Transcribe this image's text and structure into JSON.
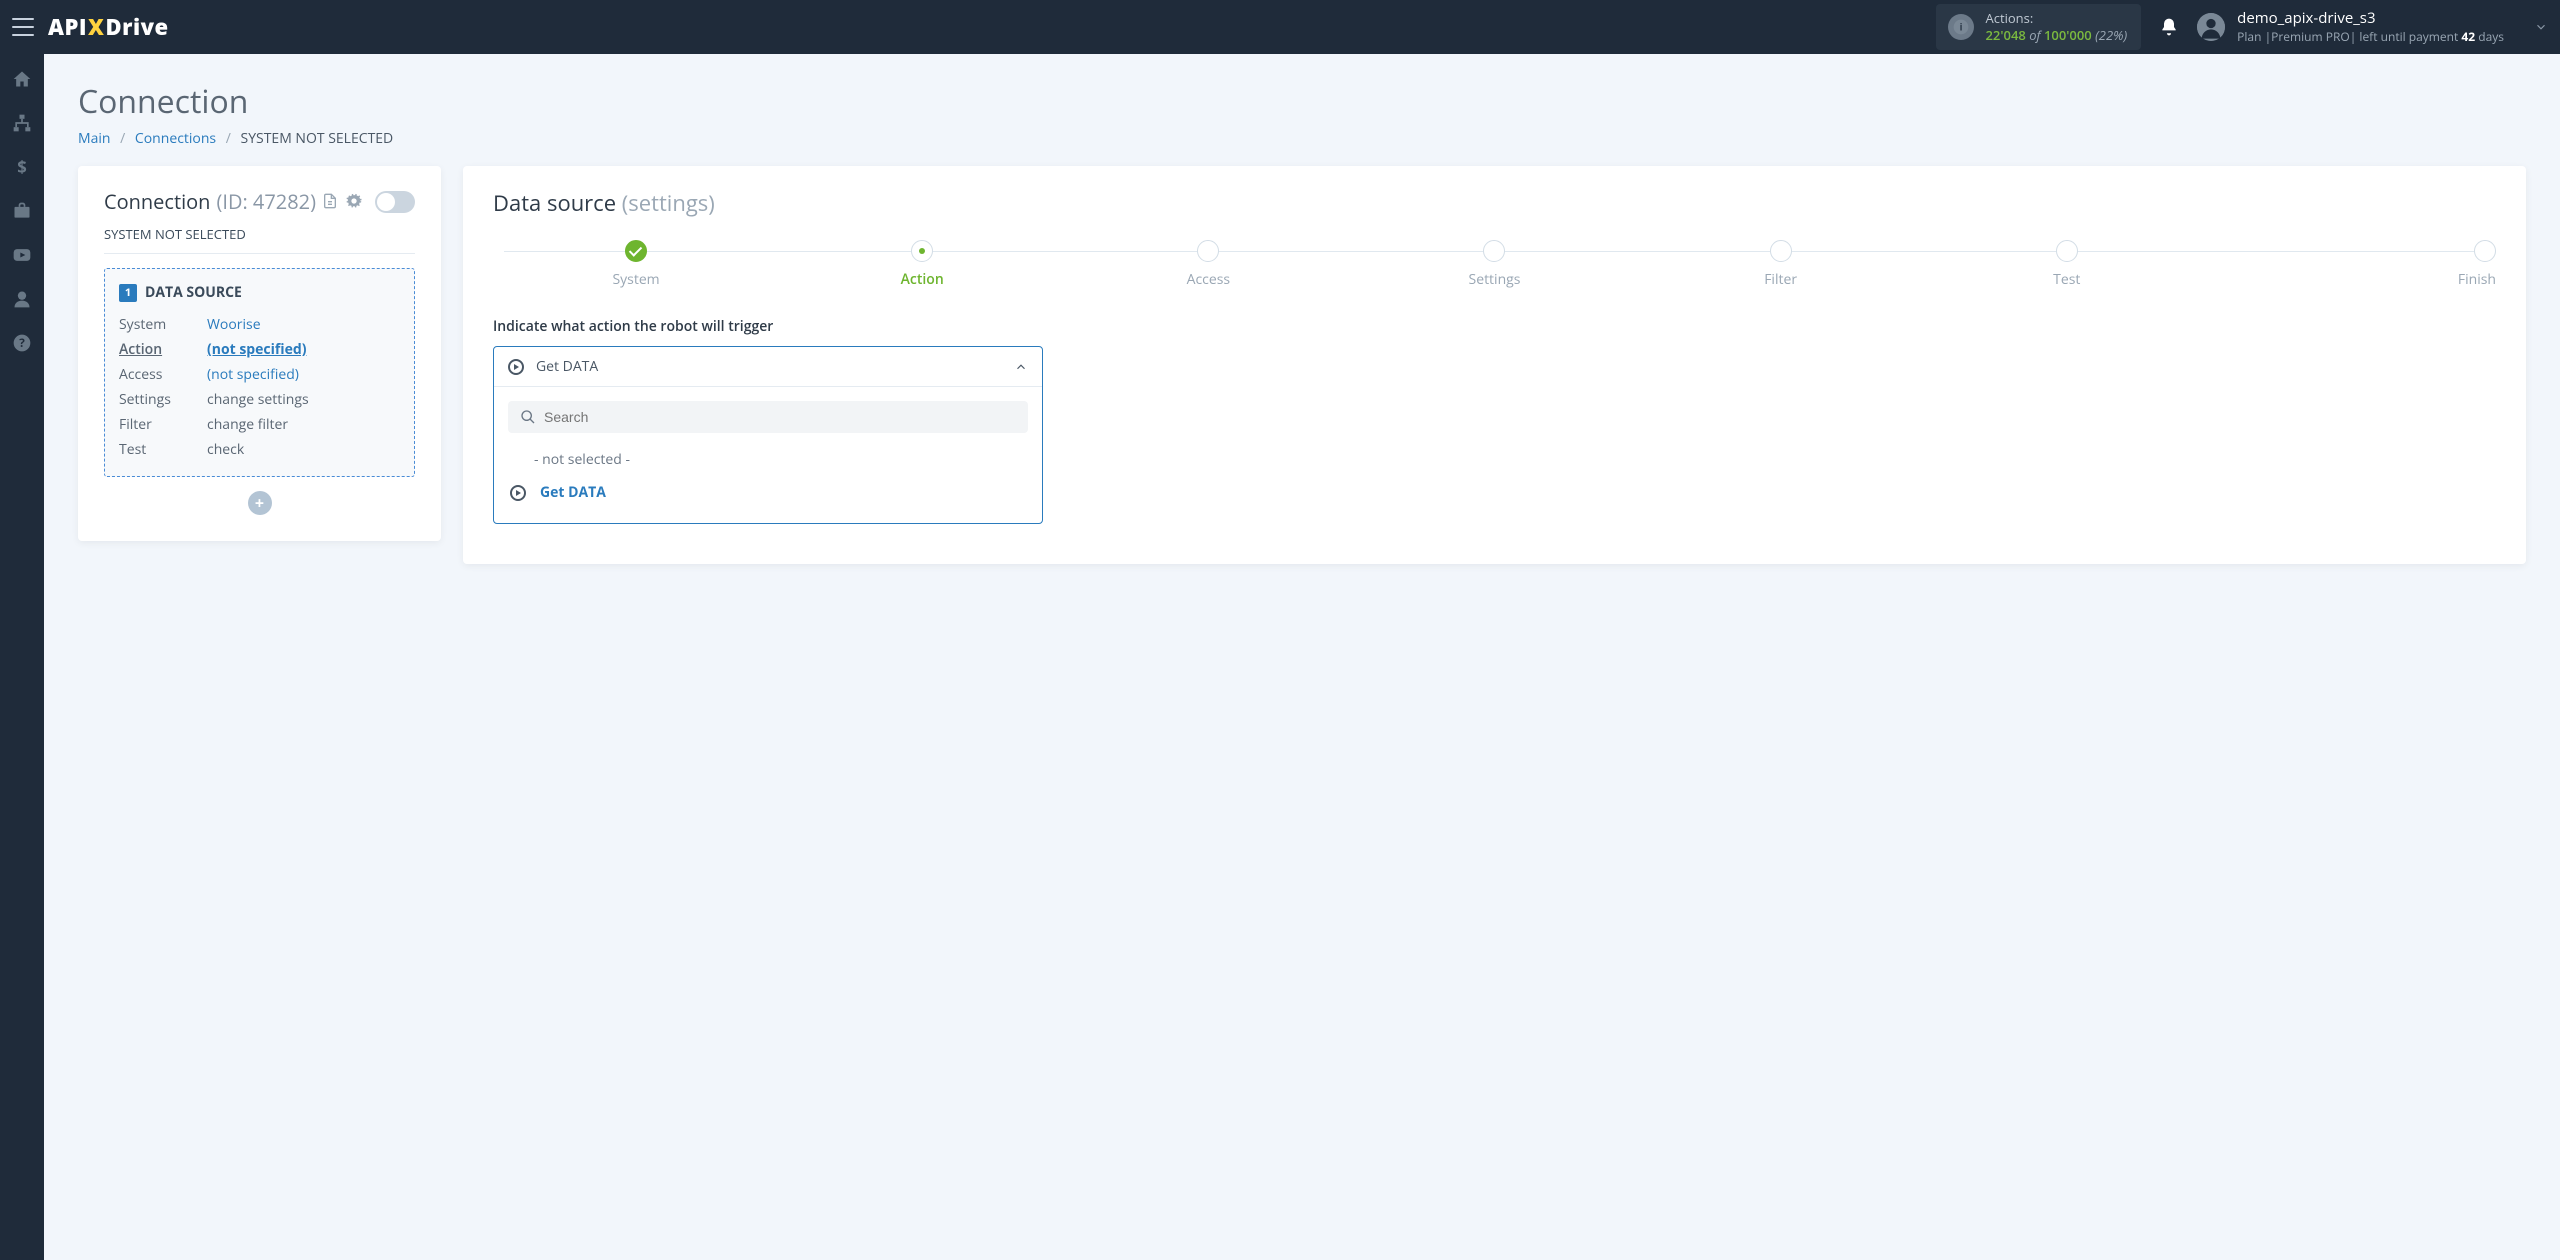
{
  "header": {
    "logo_api": "API",
    "logo_drive": "Drive",
    "actions_label": "Actions:",
    "actions_used": "22'048",
    "actions_of": " of ",
    "actions_total": "100'000",
    "actions_pct": " (22%)",
    "user_name": "demo_apix-drive_s3",
    "plan_prefix": "Plan  |Premium PRO|  left until payment ",
    "plan_days": "42",
    "plan_suffix": " days"
  },
  "page": {
    "title": "Connection",
    "crumb_main": "Main",
    "crumb_connections": "Connections",
    "crumb_current": "SYSTEM NOT SELECTED"
  },
  "left": {
    "title": "Connection ",
    "id": "(ID: 47282)",
    "sys_label": "SYSTEM NOT SELECTED",
    "ds_num": "1",
    "ds_label": "DATA SOURCE",
    "rows": {
      "system_k": "System",
      "system_v": "Woorise",
      "action_k": "Action",
      "action_v": "(not specified)",
      "access_k": "Access",
      "access_v": "(not specified)",
      "settings_k": "Settings",
      "settings_v": "change settings",
      "filter_k": "Filter",
      "filter_v": "change filter",
      "test_k": "Test",
      "test_v": "check"
    }
  },
  "right": {
    "title": "Data source ",
    "subtitle": "(settings)",
    "steps": [
      "System",
      "Action",
      "Access",
      "Settings",
      "Filter",
      "Test",
      "Finish"
    ],
    "field_label": "Indicate what action the robot will trigger",
    "selected": "Get DATA",
    "search_placeholder": "Search",
    "opt_none": "- not selected -",
    "opt_get": "Get DATA"
  }
}
